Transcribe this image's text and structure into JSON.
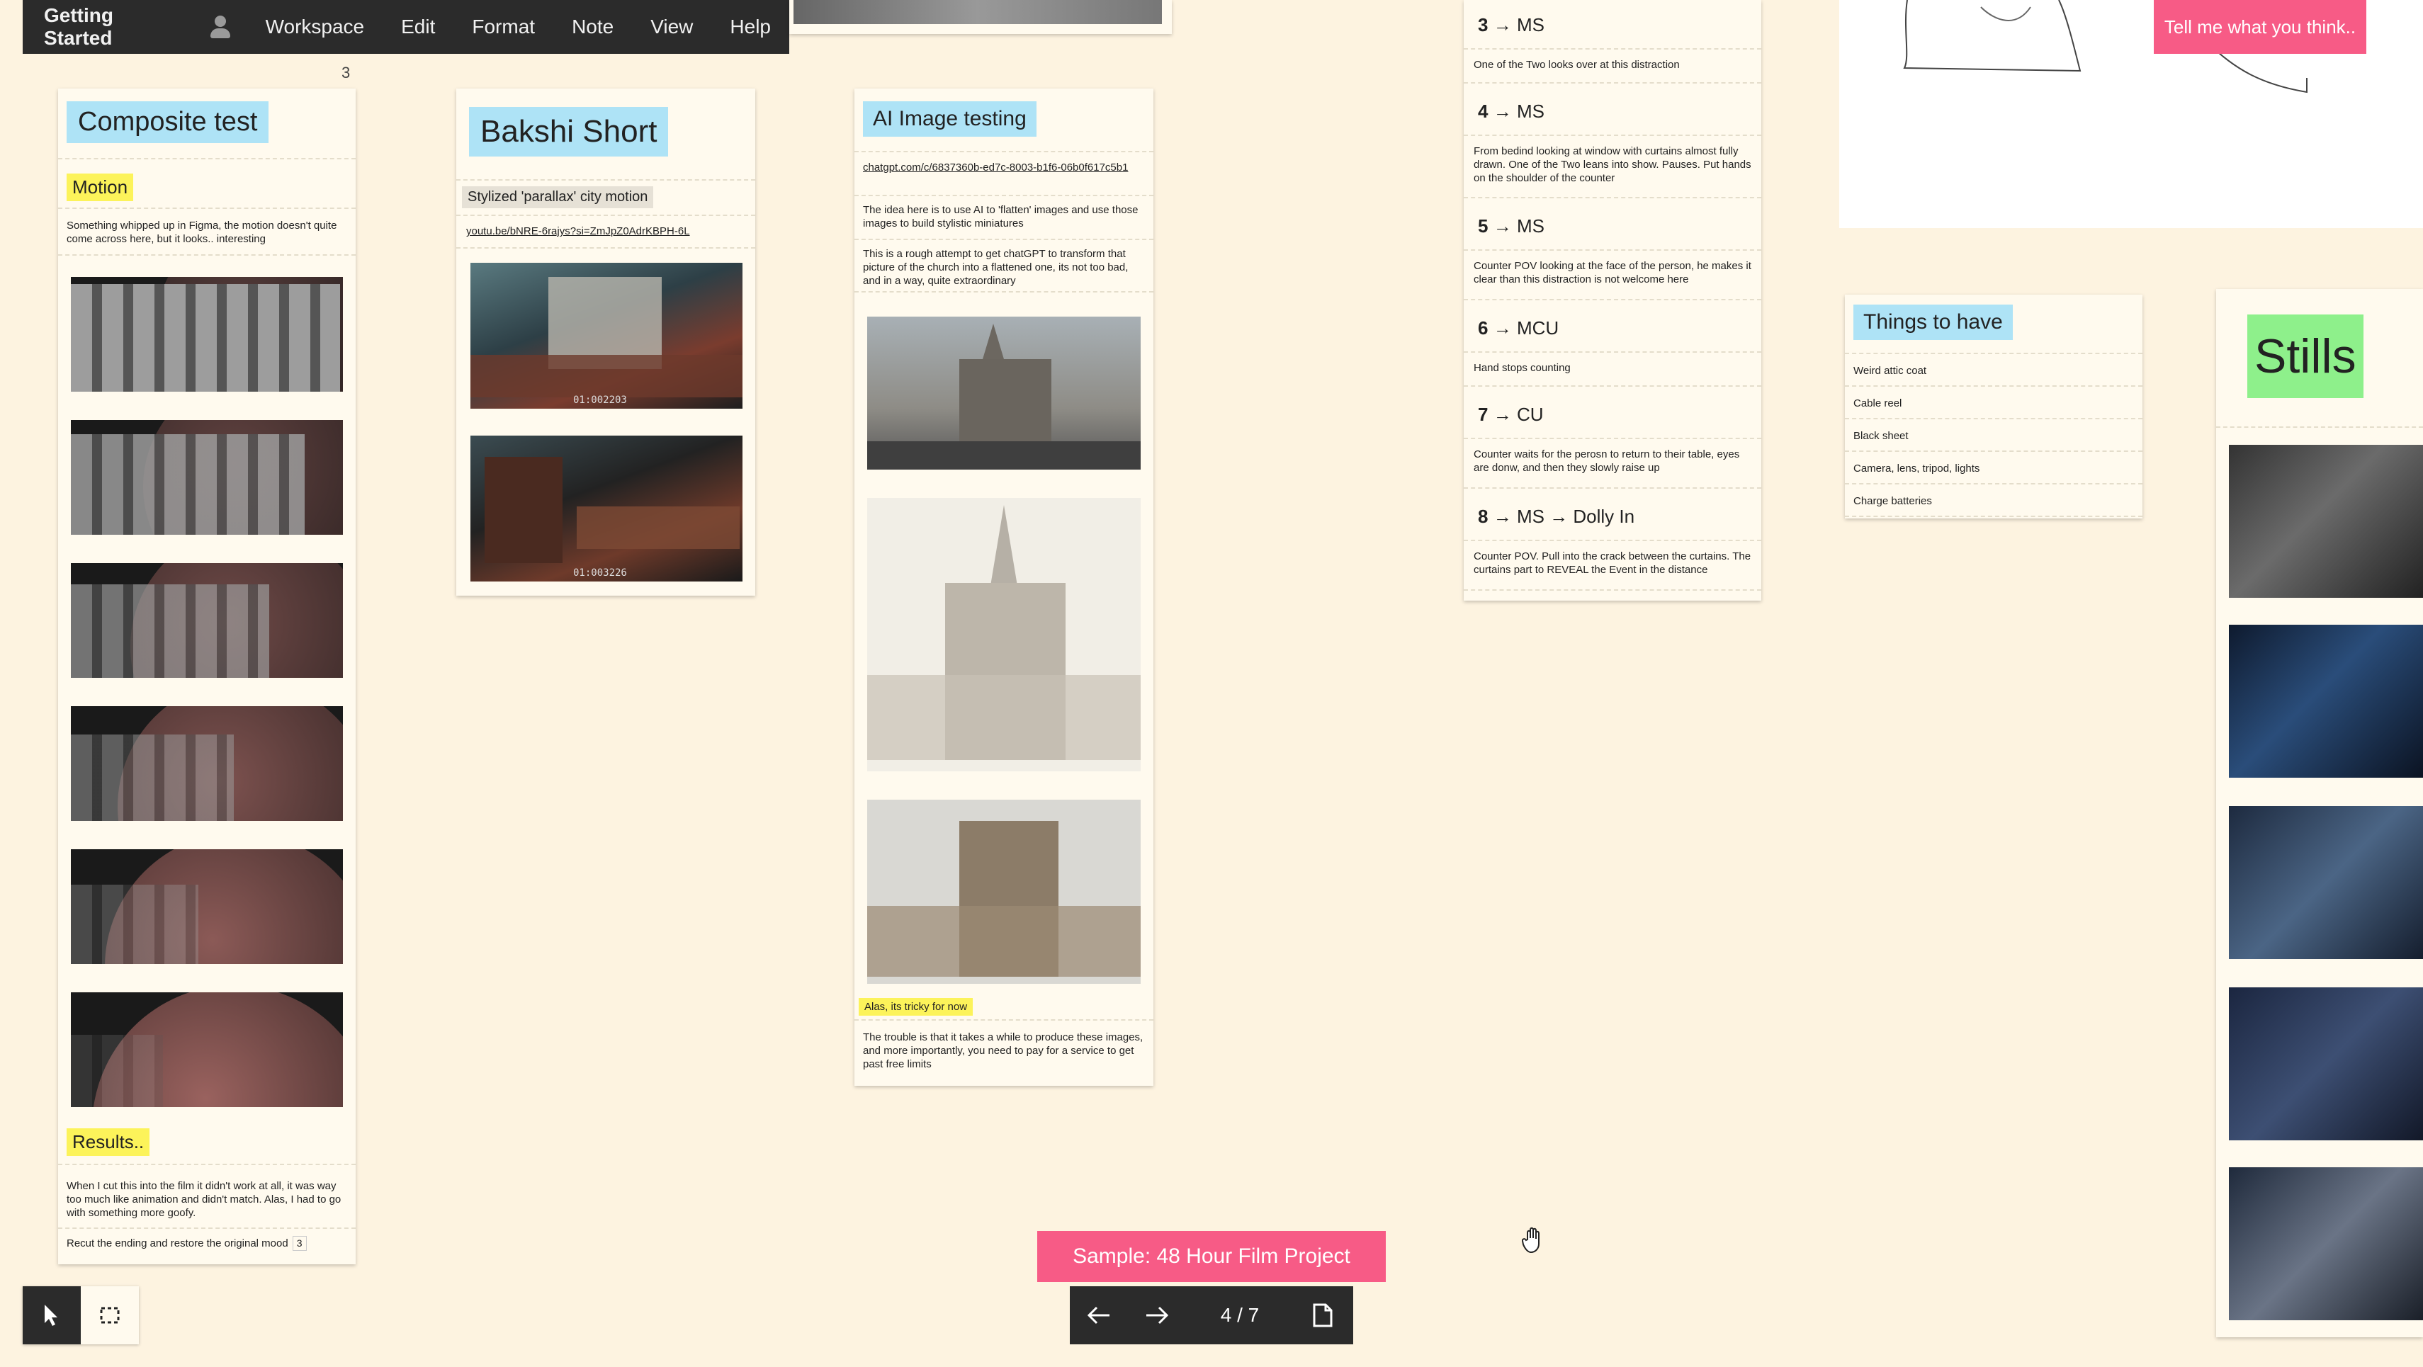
{
  "menu": {
    "title": "Getting Started",
    "items": [
      "Workspace",
      "Edit",
      "Format",
      "Note",
      "View",
      "Help"
    ]
  },
  "corner_count": "3",
  "composite": {
    "title": "Composite test",
    "motion_label": "Motion",
    "motion_text": "Something whipped up in Figma, the motion doesn't quite come across here, but it looks.. interesting",
    "results_label": "Results..",
    "results_text": "When I cut this into the film it didn't work at all, it was way too much like animation and didn't match. Alas, I had to go with something more goofy.",
    "task_text": "Recut the ending and restore the original mood",
    "task_count": "3"
  },
  "bakshi": {
    "title": "Bakshi Short",
    "tag": "Stylized 'parallax' city motion",
    "link": "youtu.be/bNRE-6rajys?si=ZmJpZ0AdrKBPH-6L",
    "tc1": "01:002203",
    "tc2": "01:003226"
  },
  "ai": {
    "title": "AI Image testing",
    "link": "chatgpt.com/c/6837360b-ed7c-8003-b1f6-06b0f617c5b1",
    "text1": "The idea here is to use AI to 'flatten' images and use those images to build stylistic miniatures",
    "text2": "This is a rough attempt to get chatGPT to transform that picture of the church into a flattened one, its not too bad, and in a way, quite extraordinary",
    "note_label": "Alas, its tricky for now",
    "text3": "The trouble is that it takes a while to produce these images, and more importantly, you need to pay for a service to get past free limits"
  },
  "shots": [
    {
      "num": "3",
      "type": "MS",
      "desc": "One of the Two looks over at this distraction"
    },
    {
      "num": "4",
      "type": "MS",
      "desc": "From bedind looking at window with curtains almost fully drawn. One of the Two leans into show. Pauses. Put hands on the shoulder of the counter"
    },
    {
      "num": "5",
      "type": "MS",
      "desc": "Counter POV looking at the face of the person, he makes it clear than this distraction is not welcome here"
    },
    {
      "num": "6",
      "type": "MCU",
      "desc": "Hand stops counting"
    },
    {
      "num": "7",
      "type": "CU",
      "desc": "Counter waits for the perosn to return to their table, eyes are donw, and then they slowly raise up"
    },
    {
      "num": "8",
      "type": "MS → Dolly In",
      "desc": "Counter POV. Pull into the crack between the curtains. The curtains part to REVEAL the Event in the distance"
    }
  ],
  "arrow": "→",
  "things": {
    "title": "Things to have",
    "items": [
      "Weird attic coat",
      "Cable reel",
      "Black sheet",
      "Camera, lens, tripod, lights",
      "Charge batteries"
    ]
  },
  "stills": {
    "title": "Stills"
  },
  "feedback": {
    "label": "Tell me what you think.."
  },
  "presentation": {
    "label": "Sample: 48 Hour Film Project",
    "page": "4 / 7"
  },
  "colors": {
    "background": "#fdf3e0",
    "accent_pink": "#f75b86",
    "toolbar": "#2b2b2b",
    "tag_blue": "#aee3f6",
    "tag_yellow": "#fcf35a",
    "tag_green": "#8ef08b"
  }
}
